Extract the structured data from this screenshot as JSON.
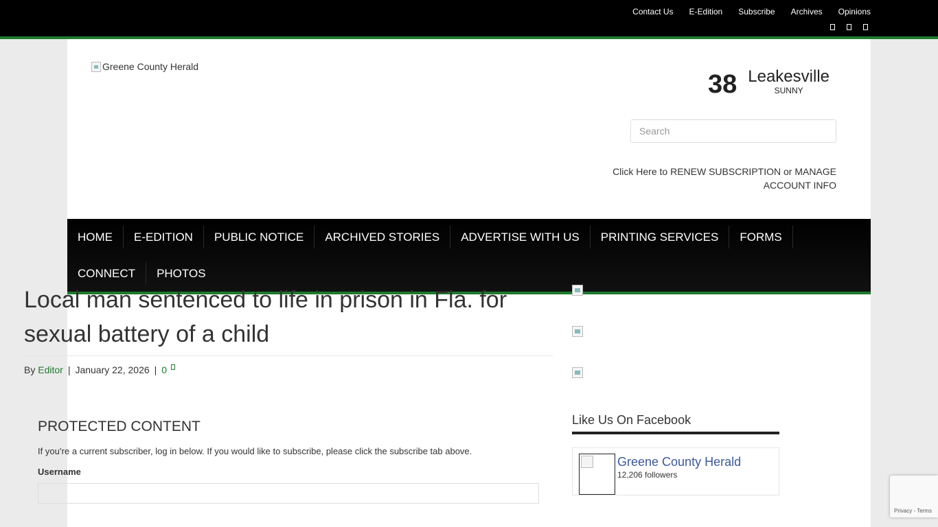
{
  "topbar": {
    "links": [
      "Contact Us",
      "E-Edition",
      "Subscribe",
      "Archives",
      "Opinions"
    ],
    "social_icons": [
      "facebook-icon",
      "twitter-icon",
      "rss-icon"
    ]
  },
  "header": {
    "logo_alt": "Greene County Herald",
    "weather": {
      "temp": "38",
      "city": "Leakesville",
      "condition": "SUNNY"
    },
    "search_placeholder": "Search",
    "renew_text": "Click Here to RENEW SUBSCRIPTION or MANAGE ACCOUNT INFO"
  },
  "nav": {
    "row1": [
      "HOME",
      "E-EDITION",
      "PUBLIC NOTICE",
      "ARCHIVED STORIES",
      "ADVERTISE WITH US",
      "PRINTING SERVICES",
      "FORMS"
    ],
    "row2": [
      "CONNECT",
      "PHOTOS"
    ]
  },
  "article": {
    "title": "Local man sentenced to life in prison in Fla. for sexual battery of a child",
    "by": "By",
    "author": "Editor",
    "date": "January 22, 2026",
    "comments": "0",
    "sep": "|"
  },
  "protected": {
    "heading": "PROTECTED CONTENT",
    "text": "If you’re a current subscriber, log in below. If you would like to subscribe, please click the subscribe tab above.",
    "username_label": "Username"
  },
  "sidebar": {
    "fb_title": "Like Us On Facebook",
    "fb_name": "Greene County Herald",
    "fb_followers": "12,206 followers"
  },
  "recaptcha": {
    "links": "Privacy - Terms"
  },
  "colors": {
    "accent": "#1d7a2d",
    "nav_bg": "#000000",
    "fb_blue": "#3b5998"
  }
}
